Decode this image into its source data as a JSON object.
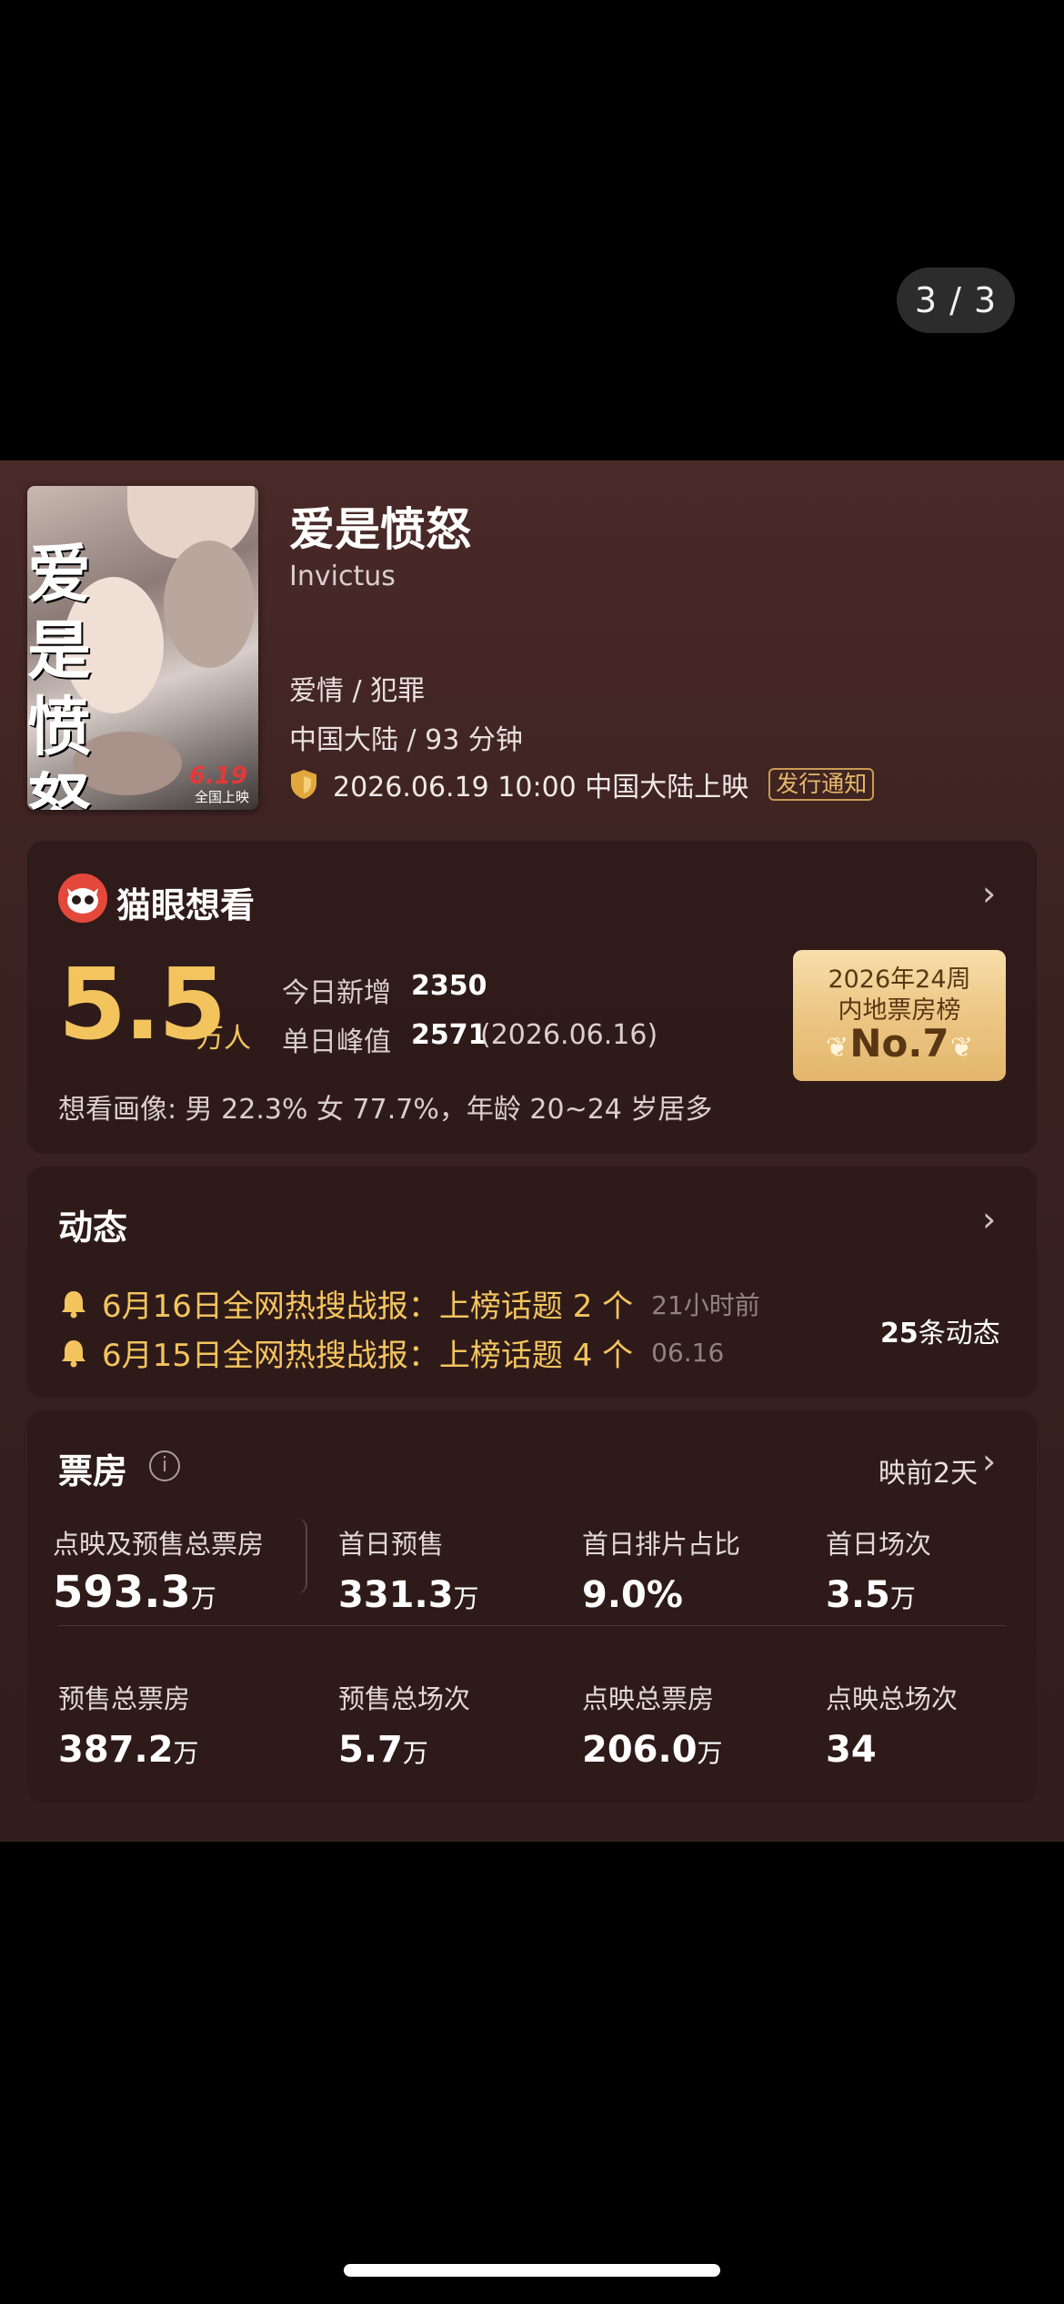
{
  "viewer": {
    "page_counter": "3 / 3"
  },
  "movie": {
    "title": "爱是愤怒",
    "english_title": "Invictus",
    "genre": "爱情 / 犯罪",
    "region_duration": "中国大陆 / 93 分钟",
    "release": "2026.06.19 10:00 中国大陆上映",
    "notify_label": "发行通知",
    "poster": {
      "title": "爱是愤怒",
      "date": "6.19",
      "caption": "全国上映"
    }
  },
  "want_to_see": {
    "title": "猫眼想看",
    "count": "5.5",
    "unit": "万人",
    "today_label": "今日新增",
    "today_value": "2350",
    "peak_label": "单日峰值",
    "peak_value": "2571",
    "peak_date": "(2026.06.16)",
    "rank": {
      "line1": "2026年24周",
      "line2": "内地票房榜",
      "line3": "No.7"
    },
    "audience": "想看画像: 男 22.3%  女 77.7%，年龄 20~24 岁居多"
  },
  "news": {
    "title": "动态",
    "items": [
      {
        "text": "6月16日全网热搜战报：上榜话题 2 个",
        "time": "21小时前"
      },
      {
        "text": "6月15日全网热搜战报：上榜话题 4 个",
        "time": "06.16"
      }
    ],
    "count_value": "25",
    "count_label": "条动态"
  },
  "box_office": {
    "title": "票房",
    "days_label": "映前2天",
    "row1": [
      {
        "label": "点映及预售总票房",
        "value": "593.3",
        "unit": "万"
      },
      {
        "label": "首日预售",
        "value": "331.3",
        "unit": "万"
      },
      {
        "label": "首日排片占比",
        "value": "9.0%",
        "unit": ""
      },
      {
        "label": "首日场次",
        "value": "3.5",
        "unit": "万"
      }
    ],
    "row2": [
      {
        "label": "预售总票房",
        "value": "387.2",
        "unit": "万"
      },
      {
        "label": "预售总场次",
        "value": "5.7",
        "unit": "万"
      },
      {
        "label": "点映总票房",
        "value": "206.0",
        "unit": "万"
      },
      {
        "label": "点映总场次",
        "value": "34",
        "unit": ""
      }
    ]
  },
  "colors": {
    "accent_gold": "#f3c45e",
    "panel_bg": "#3d2321",
    "tag_gold": "#c99b52",
    "cat_red": "#e3483b"
  }
}
